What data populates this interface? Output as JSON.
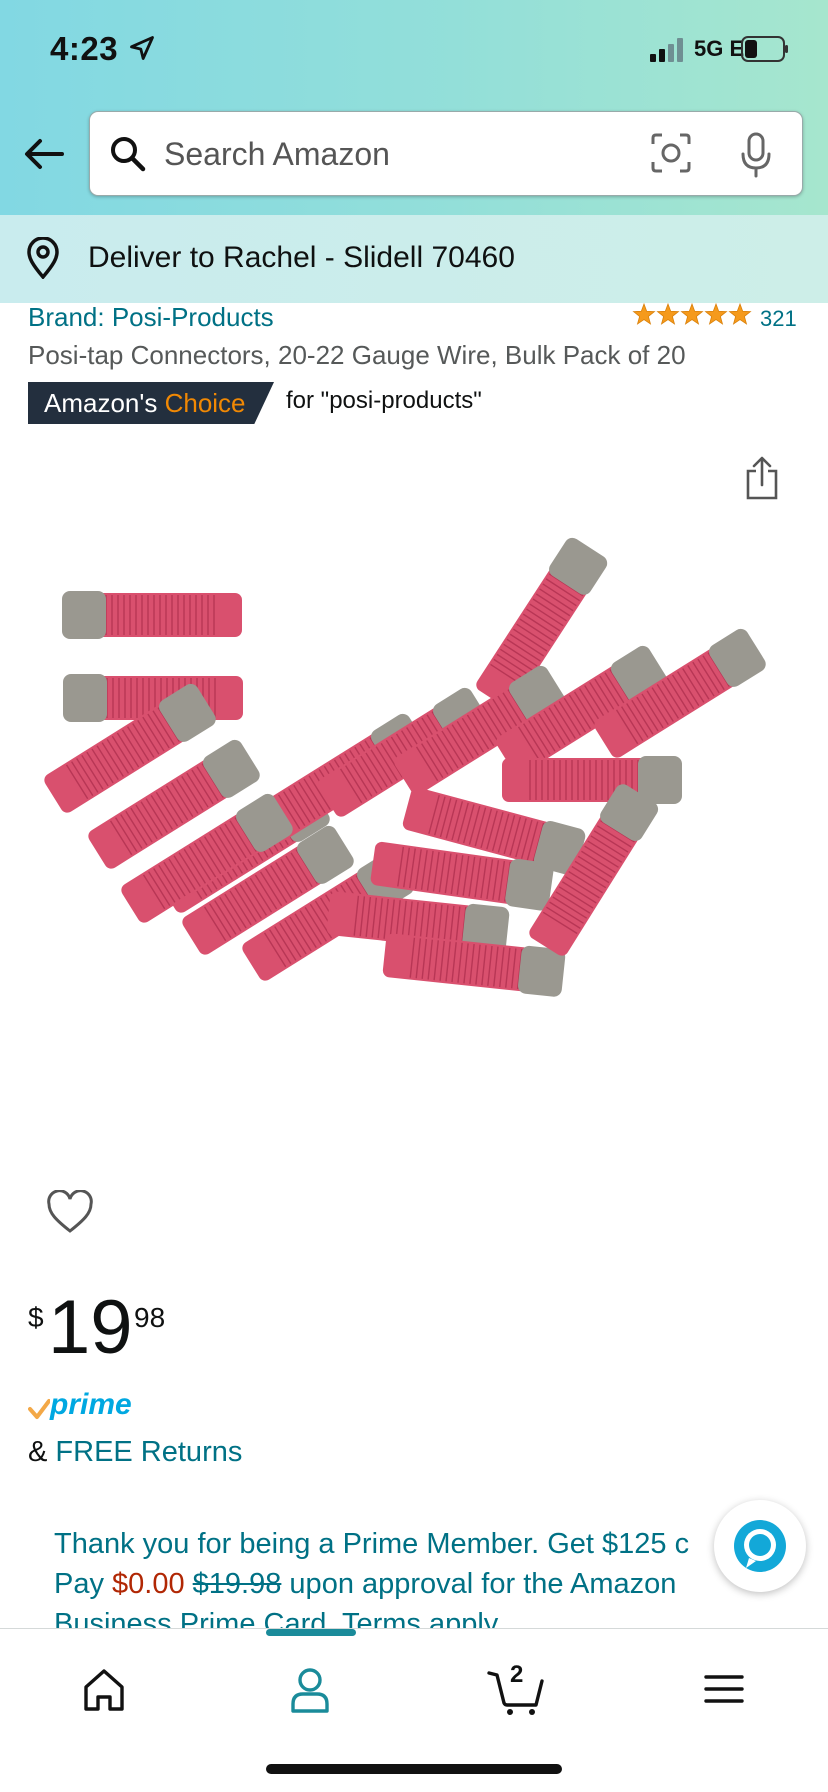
{
  "status_bar": {
    "time": "4:23",
    "network": "5G E"
  },
  "search": {
    "placeholder": "Search Amazon"
  },
  "delivery": {
    "text": "Deliver to Rachel - Slidell 70460"
  },
  "product": {
    "brand": "Brand: Posi-Products",
    "rating_count": "321",
    "rating_stars": 5,
    "title": "Posi-tap Connectors, 20-22 Gauge Wire, Bulk Pack of 20",
    "badge": {
      "amazons": "Amazon's",
      "choice": "Choice",
      "for_text": "for \"posi-products\""
    }
  },
  "price": {
    "symbol": "$",
    "whole": "19",
    "fraction": "98"
  },
  "prime": {
    "label": "prime"
  },
  "returns": {
    "prefix": "& ",
    "link": "FREE Returns"
  },
  "promo": {
    "line1": "Thank you for being a Prime Member. Get $125 c",
    "line2_prefix": "Pay ",
    "line2_price": "$0.00",
    "line2_strike": "$19.98",
    "line2_suffix": " upon approval for the Amazon",
    "line3": "Business Prime Card. Terms apply."
  },
  "bottom_nav": {
    "items": [
      "home-icon",
      "account-icon",
      "cart-icon",
      "menu-icon"
    ],
    "cart_count": "2"
  },
  "colors": {
    "link": "#007185",
    "price_red": "#b12704",
    "badge_bg": "#232f3e",
    "choice_orange": "#f08804",
    "connector_red": "#d9506e",
    "connector_gray": "#9a9890"
  }
}
